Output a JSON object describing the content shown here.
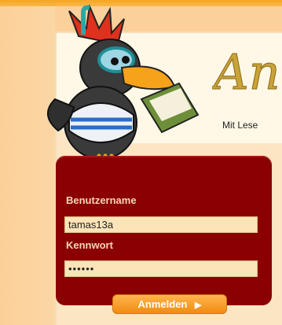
{
  "brand": {
    "title_fragment": "An",
    "tagline": "Mit Lese"
  },
  "login": {
    "username_label": "Benutzername",
    "username_value": "tamas13a",
    "password_label": "Kennwort",
    "password_value": "••••••",
    "submit_label": "Anmelden",
    "submit_icon": "play-triangle-icon"
  },
  "mascot": {
    "icon": "raven-with-book-icon"
  }
}
